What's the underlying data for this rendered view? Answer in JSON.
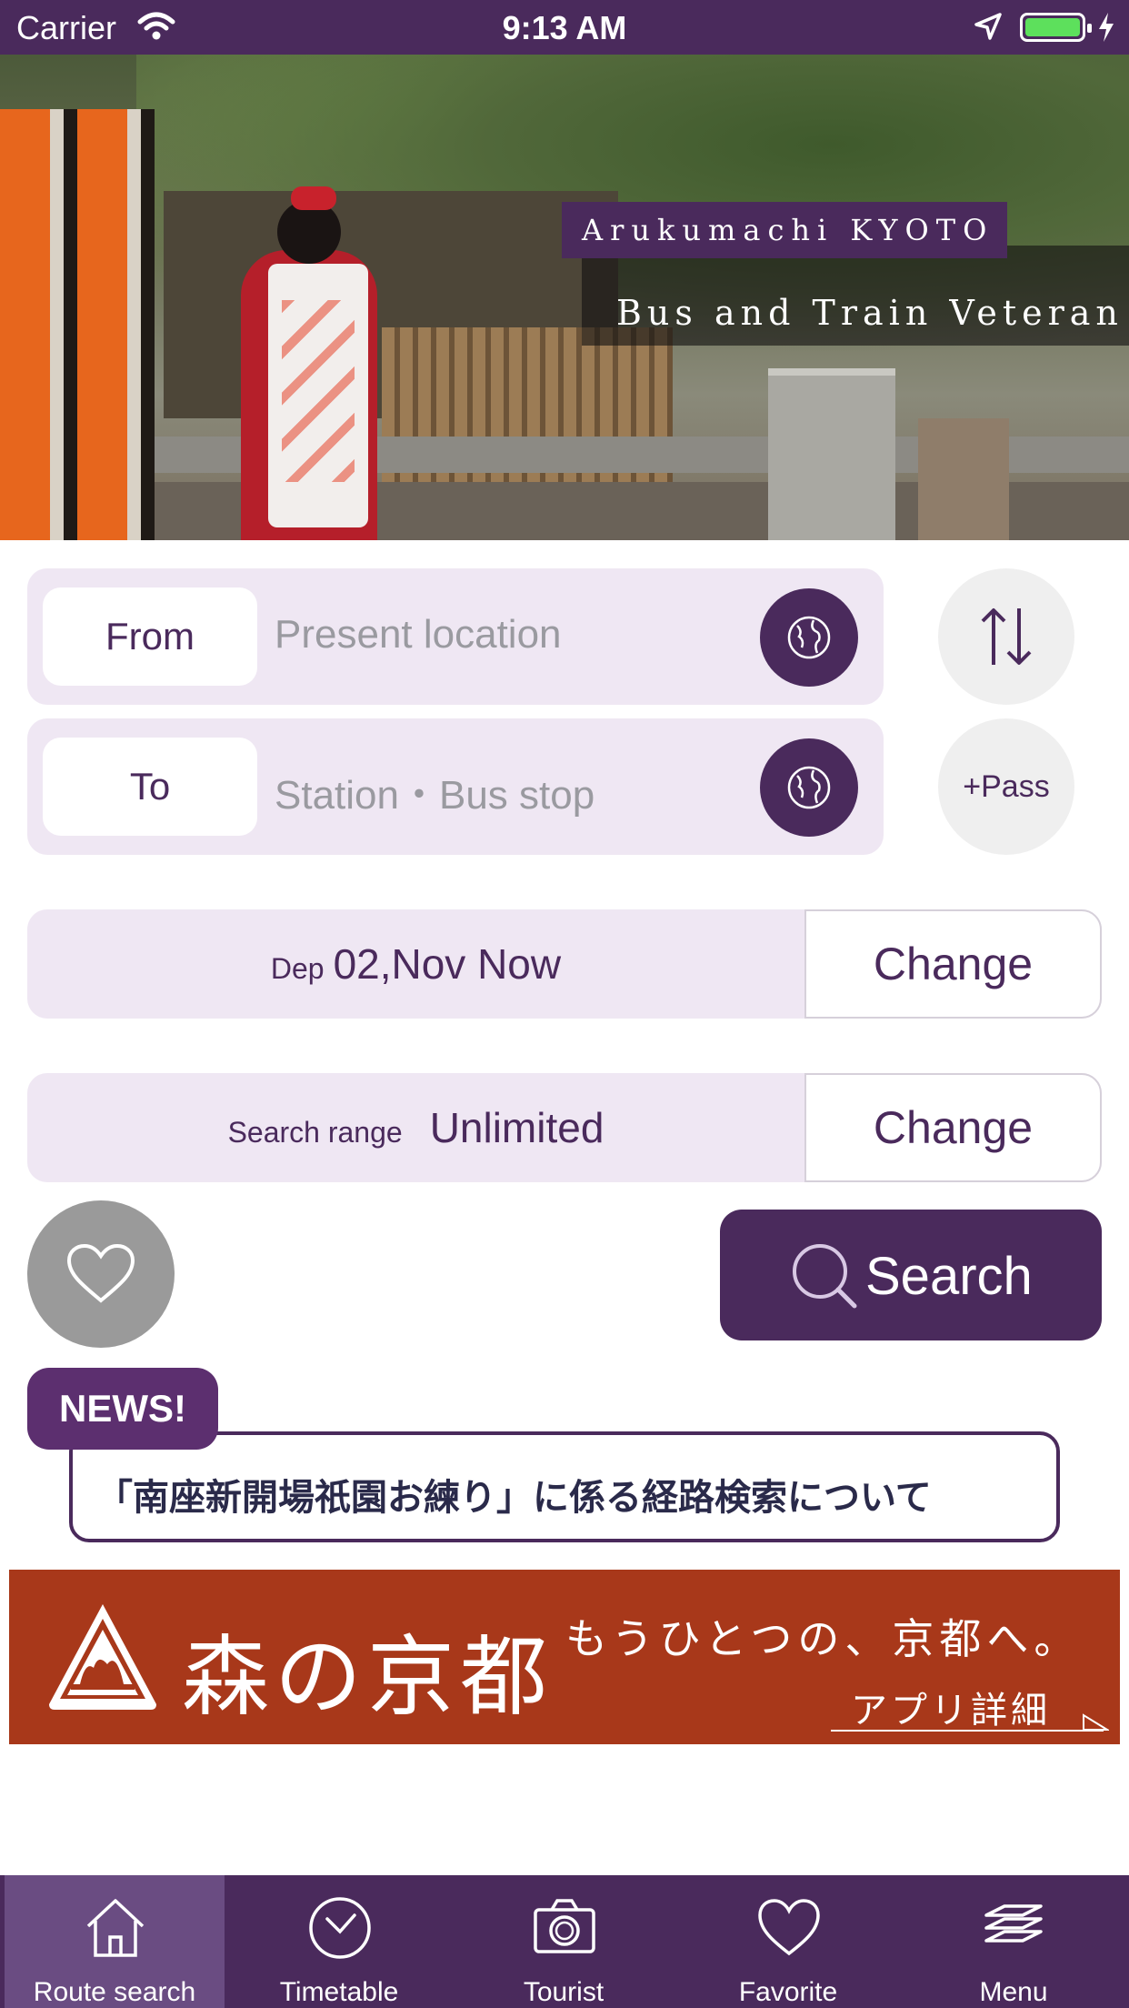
{
  "status_bar": {
    "carrier": "Carrier",
    "time": "9:13 AM"
  },
  "hero": {
    "title": "Arukumachi KYOTO",
    "subtitle": "Bus and Train Veteran"
  },
  "route": {
    "from_label": "From",
    "from_placeholder": "Present location",
    "to_label": "To",
    "to_placeholder": "Station・Bus stop",
    "pass_label": "+Pass"
  },
  "departure": {
    "prefix": "Dep",
    "value": "02,Nov Now",
    "change_label": "Change"
  },
  "search_range": {
    "prefix": "Search range",
    "value": "Unlimited",
    "change_label": "Change"
  },
  "search": {
    "label": "Search"
  },
  "news": {
    "badge": "NEWS!",
    "headline": "「南座新開場祇園お練り」に係る経路検索について"
  },
  "banner": {
    "title": "森の京都",
    "tagline": "もうひとつの、京都へ。",
    "link": "アプリ詳細"
  },
  "tabs": [
    {
      "label": "Route search",
      "icon": "home-icon",
      "active": true
    },
    {
      "label": "Timetable",
      "icon": "clock-icon",
      "active": false
    },
    {
      "label": "Tourist",
      "icon": "camera-icon",
      "active": false
    },
    {
      "label": "Favorite",
      "icon": "heart-icon",
      "active": false
    },
    {
      "label": "Menu",
      "icon": "layers-icon",
      "active": false
    }
  ],
  "colors": {
    "brand": "#4a2a5c",
    "field_bg": "#efe7f3",
    "banner": "#a8381a",
    "battery": "#5de05c"
  }
}
